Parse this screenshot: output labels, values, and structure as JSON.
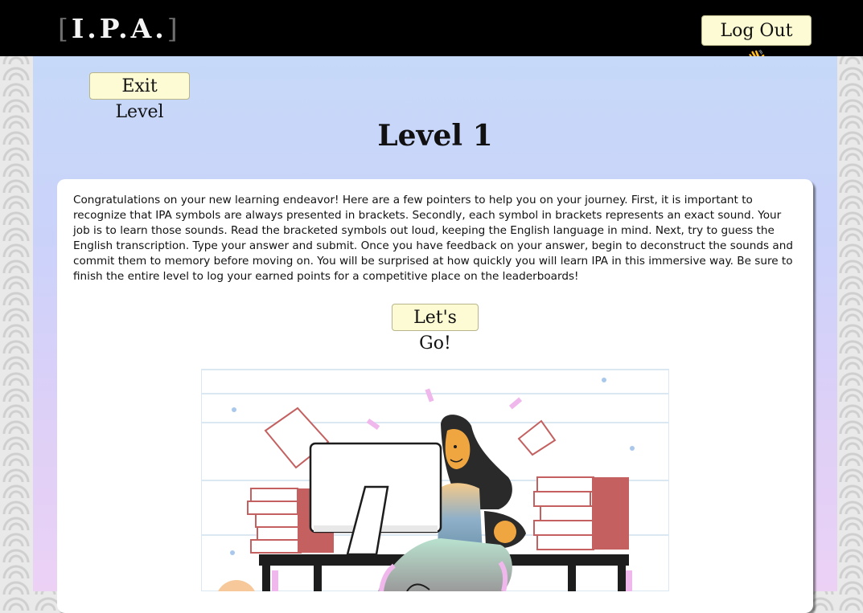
{
  "header": {
    "logo_open": "[",
    "logo_text": "I.P.A.",
    "logo_close": "]",
    "logout_label": "Log Out 👋"
  },
  "level": {
    "exit_label": "Exit Level",
    "title": "Level 1",
    "intro": "Congratulations on your new learning endeavor! Here are a few pointers to help you on your journey. First, it is important to recognize that IPA symbols are always presented in brackets. Secondly, each symbol in brackets represents an exact sound. Your job is to learn those sounds. Read the bracketed symbols out loud, keeping the English language in mind. Next, try to guess the English transcription. Type your answer and submit. Once you have feedback on your answer, begin to deconstruct the sounds and commit them to memory before moving on. You will be surprised at how quickly you will learn IPA in this immersive way. Be sure to finish the entire level to log your earned points for a competitive place on the leaderboards!",
    "start_label": "Let's Go!"
  },
  "colors": {
    "topbar": "#000000",
    "button_bg": "#fdfbd4",
    "gradient_top": "#c6d9f8",
    "gradient_bottom": "#ecd1f5"
  }
}
